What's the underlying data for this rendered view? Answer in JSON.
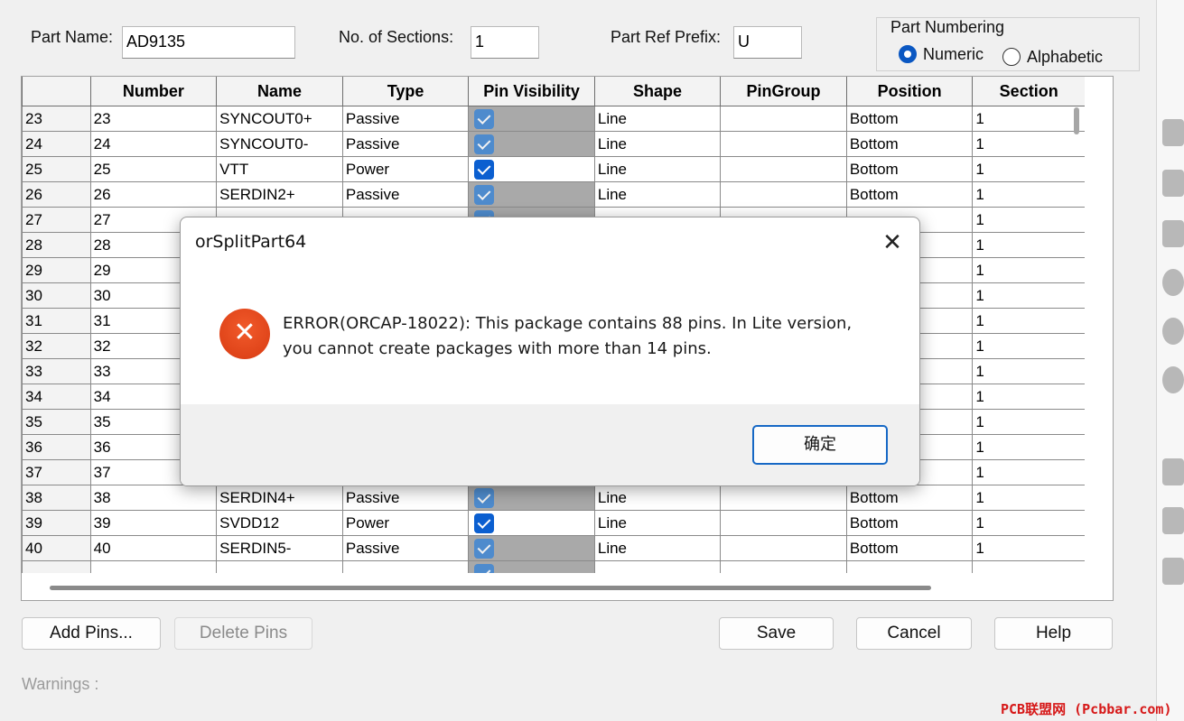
{
  "header": {
    "part_name_label": "Part Name:",
    "part_name_value": "AD9135",
    "sections_label": "No. of Sections:",
    "sections_value": "1",
    "prefix_label": "Part Ref Prefix:",
    "prefix_value": "U",
    "numbering": {
      "legend": "Part Numbering",
      "numeric_label": "Numeric",
      "alphabetic_label": "Alphabetic",
      "selected": "Numeric"
    }
  },
  "grid": {
    "columns": [
      "Number",
      "Name",
      "Type",
      "Pin Visibility",
      "Shape",
      "PinGroup",
      "Position",
      "Section"
    ],
    "rows": [
      {
        "row": "23",
        "number": "23",
        "name": "SYNCOUT0+",
        "type": "Passive",
        "visible_checked": true,
        "visible_enabled": false,
        "shape": "Line",
        "group": "",
        "position": "Bottom",
        "section": "1"
      },
      {
        "row": "24",
        "number": "24",
        "name": "SYNCOUT0-",
        "type": "Passive",
        "visible_checked": true,
        "visible_enabled": false,
        "shape": "Line",
        "group": "",
        "position": "Bottom",
        "section": "1"
      },
      {
        "row": "25",
        "number": "25",
        "name": "VTT",
        "type": "Power",
        "visible_checked": true,
        "visible_enabled": true,
        "shape": "Line",
        "group": "",
        "position": "Bottom",
        "section": "1"
      },
      {
        "row": "26",
        "number": "26",
        "name": "SERDIN2+",
        "type": "Passive",
        "visible_checked": true,
        "visible_enabled": false,
        "shape": "Line",
        "group": "",
        "position": "Bottom",
        "section": "1"
      },
      {
        "row": "27",
        "number": "27",
        "name": "",
        "type": "",
        "visible_checked": true,
        "visible_enabled": false,
        "shape": "",
        "group": "",
        "position": "",
        "section": "1"
      },
      {
        "row": "28",
        "number": "28",
        "name": "",
        "type": "",
        "visible_checked": false,
        "visible_enabled": true,
        "shape": "",
        "group": "",
        "position": "",
        "section": "1"
      },
      {
        "row": "29",
        "number": "29",
        "name": "",
        "type": "",
        "visible_checked": false,
        "visible_enabled": true,
        "shape": "",
        "group": "",
        "position": "",
        "section": "1"
      },
      {
        "row": "30",
        "number": "30",
        "name": "",
        "type": "",
        "visible_checked": false,
        "visible_enabled": true,
        "shape": "",
        "group": "",
        "position": "",
        "section": "1"
      },
      {
        "row": "31",
        "number": "31",
        "name": "",
        "type": "",
        "visible_checked": false,
        "visible_enabled": true,
        "shape": "",
        "group": "",
        "position": "",
        "section": "1"
      },
      {
        "row": "32",
        "number": "32",
        "name": "",
        "type": "",
        "visible_checked": false,
        "visible_enabled": true,
        "shape": "",
        "group": "",
        "position": "",
        "section": "1"
      },
      {
        "row": "33",
        "number": "33",
        "name": "",
        "type": "",
        "visible_checked": false,
        "visible_enabled": true,
        "shape": "",
        "group": "",
        "position": "",
        "section": "1"
      },
      {
        "row": "34",
        "number": "34",
        "name": "",
        "type": "",
        "visible_checked": false,
        "visible_enabled": true,
        "shape": "",
        "group": "",
        "position": "",
        "section": "1"
      },
      {
        "row": "35",
        "number": "35",
        "name": "",
        "type": "",
        "visible_checked": false,
        "visible_enabled": true,
        "shape": "",
        "group": "",
        "position": "",
        "section": "1"
      },
      {
        "row": "36",
        "number": "36",
        "name": "",
        "type": "",
        "visible_checked": false,
        "visible_enabled": true,
        "shape": "",
        "group": "",
        "position": "",
        "section": "1"
      },
      {
        "row": "37",
        "number": "37",
        "name": "",
        "type": "",
        "visible_checked": false,
        "visible_enabled": true,
        "shape": "",
        "group": "",
        "position": "",
        "section": "1"
      },
      {
        "row": "38",
        "number": "38",
        "name": "SERDIN4+",
        "type": "Passive",
        "visible_checked": true,
        "visible_enabled": false,
        "shape": "Line",
        "group": "",
        "position": "Bottom",
        "section": "1"
      },
      {
        "row": "39",
        "number": "39",
        "name": "SVDD12",
        "type": "Power",
        "visible_checked": true,
        "visible_enabled": true,
        "shape": "Line",
        "group": "",
        "position": "Bottom",
        "section": "1"
      },
      {
        "row": "40",
        "number": "40",
        "name": "SERDIN5-",
        "type": "Passive",
        "visible_checked": true,
        "visible_enabled": false,
        "shape": "Line",
        "group": "",
        "position": "Bottom",
        "section": "1"
      },
      {
        "row": "",
        "number": "",
        "name": "",
        "type": "",
        "visible_checked": true,
        "visible_enabled": false,
        "shape": "",
        "group": "",
        "position": "",
        "section": ""
      }
    ]
  },
  "buttons": {
    "add_pins": "Add Pins...",
    "delete_pins": "Delete Pins",
    "save": "Save",
    "cancel": "Cancel",
    "help": "Help"
  },
  "warnings_label": "Warnings :",
  "dialog": {
    "title": "orSplitPart64",
    "close_glyph": "✕",
    "icon": "error-icon",
    "message_line1": "ERROR(ORCAP-18022): This package contains 88 pins. In Lite version,",
    "message_line2": "you cannot create packages with more than 14 pins.",
    "ok_label": "确定"
  },
  "watermark": "PCB联盟网 (Pcbbar.com)",
  "colors": {
    "accent": "#0a57c2",
    "error": "#e2471c",
    "disabled_cell": "#a9a9a9"
  }
}
